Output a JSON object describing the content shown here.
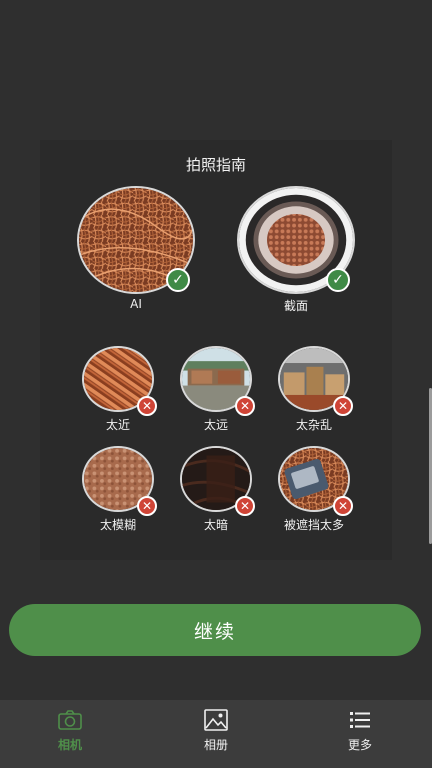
{
  "guide": {
    "title": "拍照指南",
    "good_examples": [
      {
        "label": "AI",
        "status": "ok",
        "icon": "check-icon"
      },
      {
        "label": "截面",
        "status": "ok",
        "icon": "check-icon"
      }
    ],
    "bad_examples": [
      {
        "label": "太近",
        "status": "bad",
        "icon": "cross-icon"
      },
      {
        "label": "太远",
        "status": "bad",
        "icon": "cross-icon"
      },
      {
        "label": "太杂乱",
        "status": "bad",
        "icon": "cross-icon"
      },
      {
        "label": "太模糊",
        "status": "bad",
        "icon": "cross-icon"
      },
      {
        "label": "太暗",
        "status": "bad",
        "icon": "cross-icon"
      },
      {
        "label": "被遮挡太多",
        "status": "bad",
        "icon": "cross-icon"
      }
    ]
  },
  "actions": {
    "continue_label": "继续"
  },
  "tabbar": {
    "tabs": [
      {
        "label": "相机",
        "icon": "camera-icon",
        "active": true
      },
      {
        "label": "相册",
        "icon": "gallery-icon",
        "active": false
      },
      {
        "label": "更多",
        "icon": "list-icon",
        "active": false
      }
    ]
  },
  "colors": {
    "accent": "#4f8f4a",
    "ok": "#3f8a46",
    "bad": "#cf4436",
    "background": "#2f2f2f",
    "tabbar": "#3c3c3c"
  }
}
